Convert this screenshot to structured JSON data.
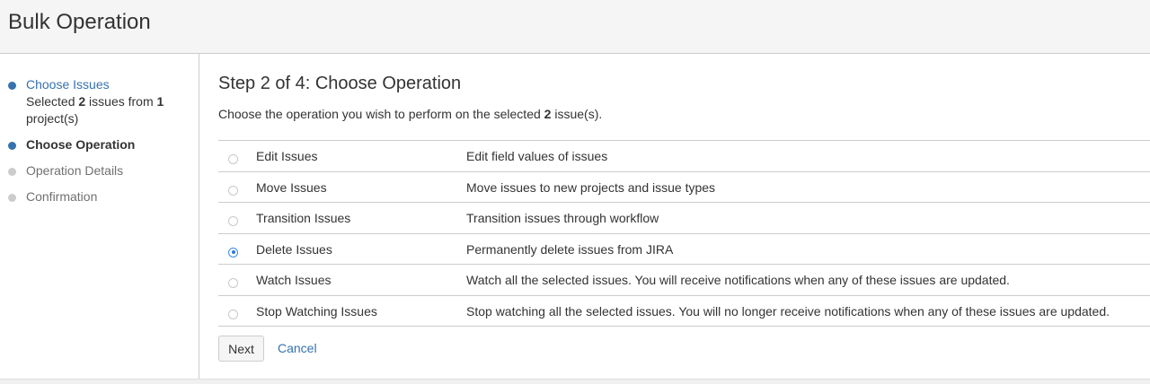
{
  "header": {
    "title": "Bulk Operation"
  },
  "sidebar": {
    "steps": [
      {
        "label": "Choose Issues",
        "state": "completed",
        "detail": {
          "prefix": "Selected ",
          "count": "2",
          "middle": " issues from ",
          "projects": "1",
          "suffix": " project(s)"
        }
      },
      {
        "label": "Choose Operation",
        "state": "current"
      },
      {
        "label": "Operation Details",
        "state": "pending"
      },
      {
        "label": "Confirmation",
        "state": "pending"
      }
    ]
  },
  "main": {
    "title": "Step 2 of 4: Choose Operation",
    "description": {
      "prefix": "Choose the operation you wish to perform on the selected ",
      "count": "2",
      "suffix": " issue(s)."
    },
    "operations": [
      {
        "name": "Edit Issues",
        "description": "Edit field values of issues",
        "selected": false
      },
      {
        "name": "Move Issues",
        "description": "Move issues to new projects and issue types",
        "selected": false
      },
      {
        "name": "Transition Issues",
        "description": "Transition issues through workflow",
        "selected": false
      },
      {
        "name": "Delete Issues",
        "description": "Permanently delete issues from JIRA",
        "selected": true
      },
      {
        "name": "Watch Issues",
        "description": "Watch all the selected issues. You will receive notifications when any of these issues are updated.",
        "selected": false
      },
      {
        "name": "Stop Watching Issues",
        "description": "Stop watching all the selected issues. You will no longer receive notifications when any of these issues are updated.",
        "selected": false
      }
    ],
    "next_label": "Next",
    "cancel_label": "Cancel"
  },
  "colors": {
    "link": "#3572b0",
    "active_dot": "#3572b0",
    "inactive_dot": "#cccccc",
    "header_bg": "#f5f5f5",
    "border": "#cccccc"
  }
}
